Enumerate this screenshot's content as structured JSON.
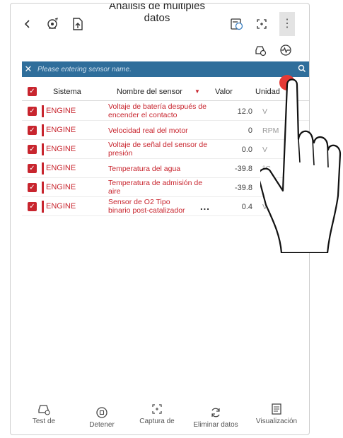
{
  "header": {
    "title": "Análisis de múltiples datos",
    "title_line1": "Análisis de múltiples",
    "title_line2": "datos"
  },
  "search": {
    "placeholder": "Please entering sensor name."
  },
  "table": {
    "headers": {
      "system": "Sistema",
      "sensor_name": "Nombre del sensor",
      "value": "Valor",
      "unit": "Unidad"
    },
    "rows": [
      {
        "system": "ENGINE",
        "name": "Voltaje de batería después de encender el contacto",
        "value": "12.0",
        "unit": "V"
      },
      {
        "system": "ENGINE",
        "name": "Velocidad real del motor",
        "value": "0",
        "unit": "RPM"
      },
      {
        "system": "ENGINE",
        "name": "Voltaje de señal del sensor de presión",
        "value": "0.0",
        "unit": "V"
      },
      {
        "system": "ENGINE",
        "name": "Temperatura del agua",
        "value": "-39.8",
        "unit": "°C"
      },
      {
        "system": "ENGINE",
        "name": "Temperatura de admisión de aire",
        "value": "-39.8",
        "unit": "°C"
      },
      {
        "system": "ENGINE",
        "name": "Sensor de O2 Tipo binario post-catalizador",
        "value": "0.4",
        "unit": "V"
      }
    ],
    "more_label": "..."
  },
  "bottom_nav": [
    {
      "label": "Test de",
      "icon": "car-test-icon"
    },
    {
      "label": "Detener",
      "icon": "stop-icon"
    },
    {
      "label": "Captura de",
      "icon": "capture-icon"
    },
    {
      "label": "Eliminar datos",
      "icon": "refresh-icon"
    },
    {
      "label": "Visualización",
      "icon": "display-icon"
    }
  ],
  "colors": {
    "accent": "#c8252e",
    "search_bar": "#2f6e9b",
    "tap_indicator": "#e53935"
  }
}
